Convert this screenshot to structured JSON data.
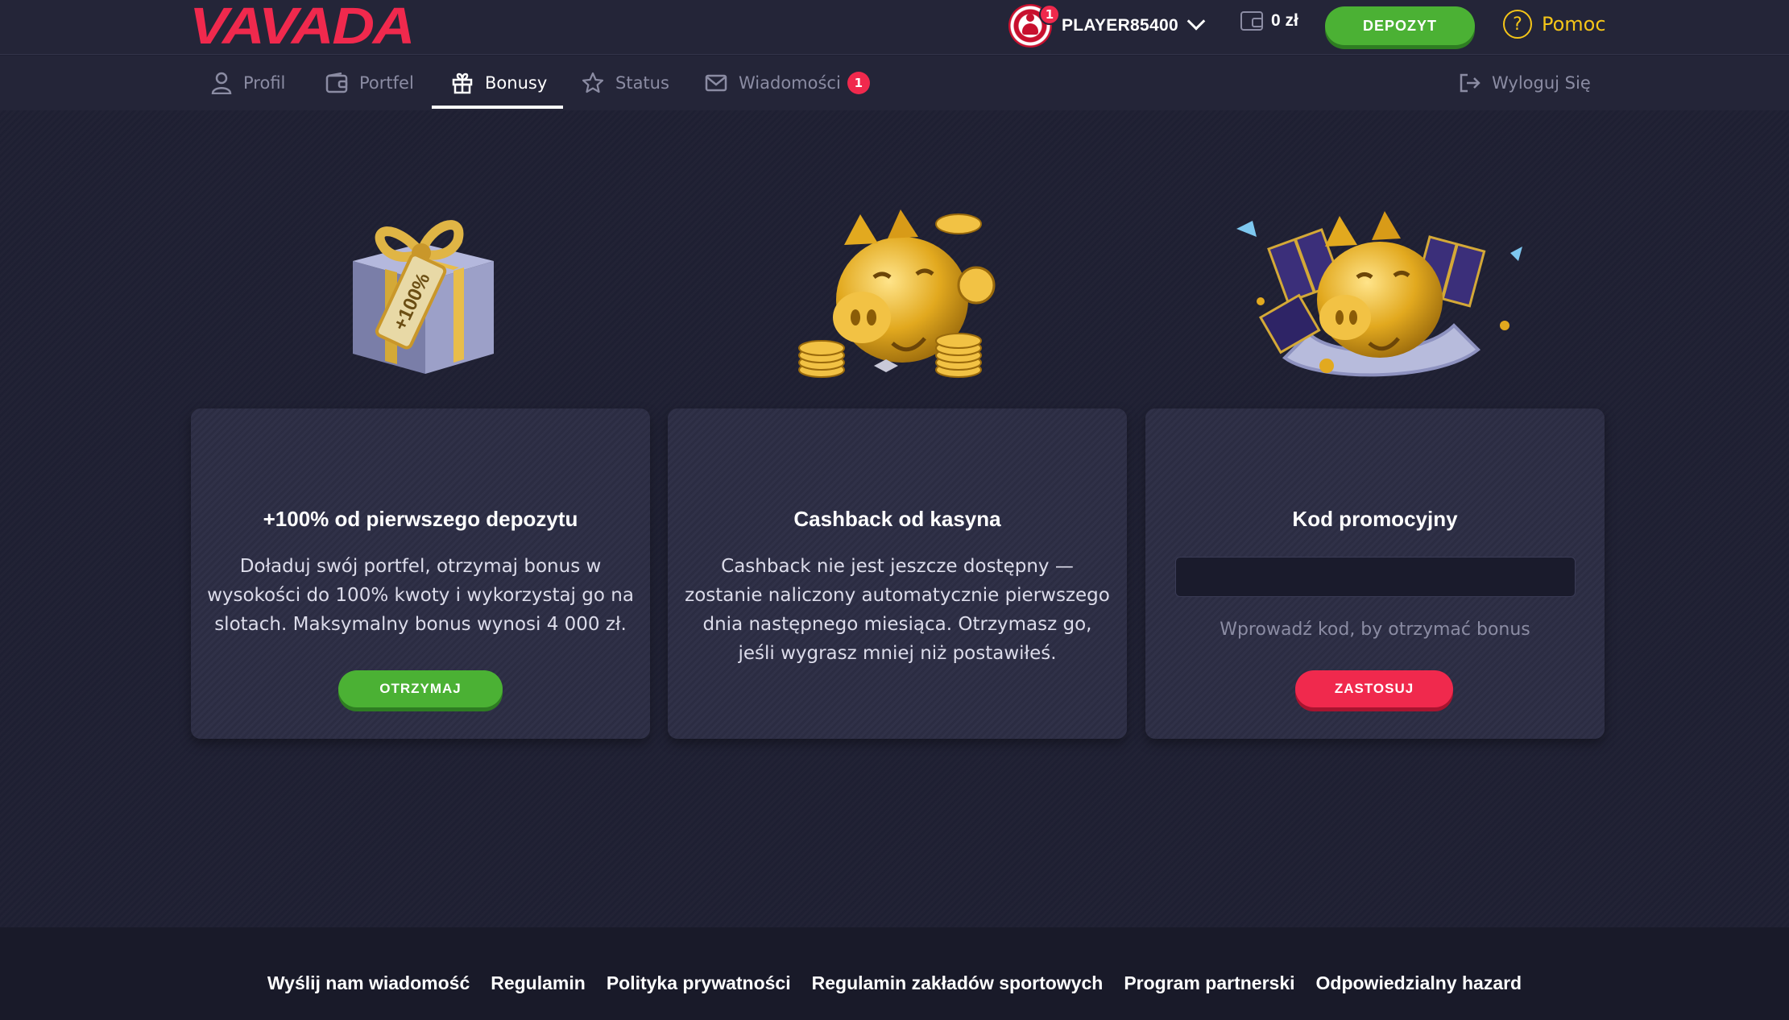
{
  "header": {
    "logo": "VAVADA",
    "username": "PLAYER85400",
    "avatar_badge": "1",
    "balance": "0 zł",
    "deposit_label": "DEPOZYT",
    "help_label": "Pomoc",
    "colors": {
      "brand": "#f0294d",
      "deposit": "#4bb134",
      "help": "#f5c518"
    }
  },
  "nav": {
    "items": [
      {
        "label": "Profil",
        "icon": "user-icon"
      },
      {
        "label": "Portfel",
        "icon": "wallet-icon"
      },
      {
        "label": "Bonusy",
        "icon": "gift-icon",
        "active": true
      },
      {
        "label": "Status",
        "icon": "star-icon"
      },
      {
        "label": "Wiadomości",
        "icon": "envelope-icon",
        "badge": "1"
      }
    ],
    "logout_label": "Wyloguj Się"
  },
  "cards": [
    {
      "title": "+100% od pierwszego depozytu",
      "text": "Doładuj swój portfel, otrzymaj bonus w wysokości do 100% kwoty i wykorzystaj go na slotach. Maksymalny bonus wynosi 4 000 zł.",
      "button": "OTRZYMAJ",
      "illustration": "gift-box-icon",
      "tag": "+100%"
    },
    {
      "title": "Cashback od kasyna",
      "text": "Cashback nie jest jeszcze dostępny — zostanie naliczony automatycznie pierwszego dnia następnego miesiąca. Otrzymasz go, jeśli wygrasz mniej niż postawiłeś.",
      "illustration": "piggy-bank-icon"
    },
    {
      "title": "Kod promocyjny",
      "input_value": "",
      "hint": "Wprowadź kod, by otrzymać bonus",
      "button": "ZASTOSUJ",
      "illustration": "piggy-bank-gifts-icon"
    }
  ],
  "footer": {
    "links": [
      "Wyślij nam wiadomość",
      "Regulamin",
      "Polityka prywatności",
      "Regulamin zakładów sportowych",
      "Program partnerski",
      "Odpowiedzialny hazard"
    ]
  }
}
